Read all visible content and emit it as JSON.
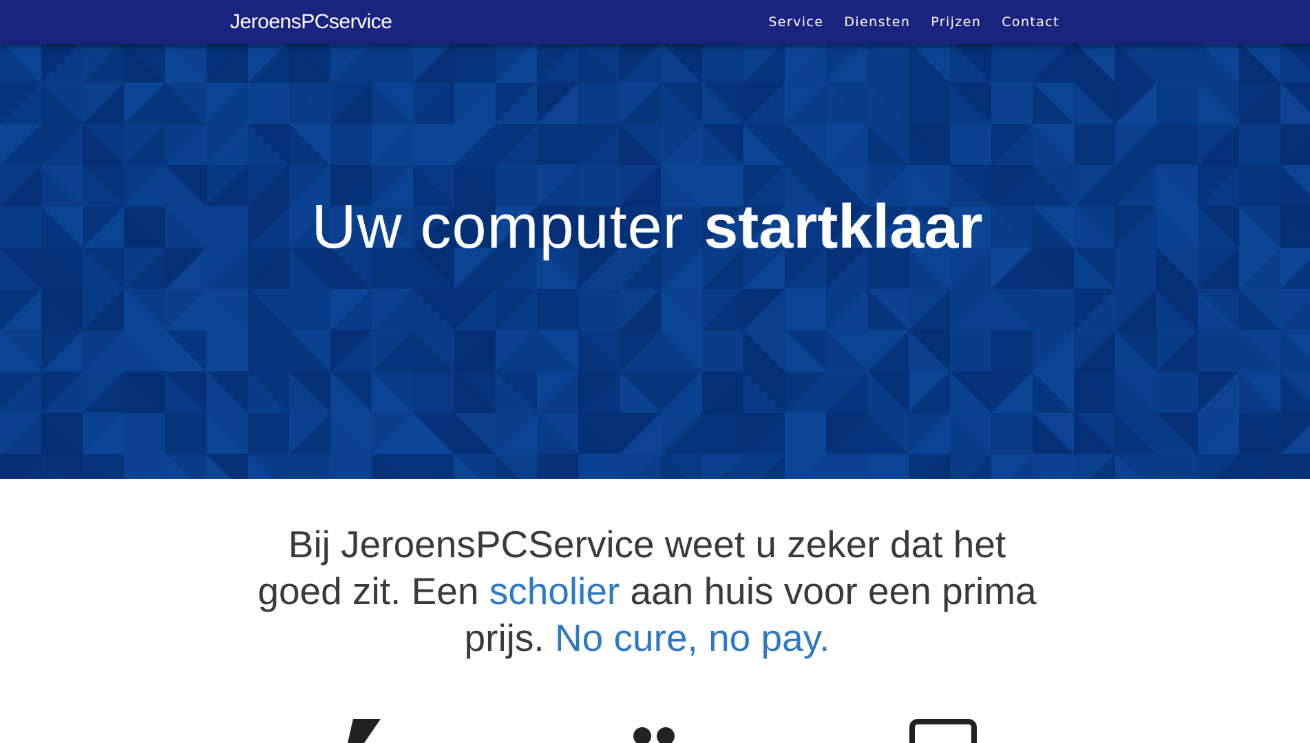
{
  "navbar": {
    "brand": "JeroensPCservice",
    "links": [
      "Service",
      "Diensten",
      "Prijzen",
      "Contact"
    ]
  },
  "hero": {
    "title_light": "Uw computer",
    "title_bold": "startklaar"
  },
  "intro": {
    "part1": "Bij JeroensPCService weet u zeker dat het goed zit. Een",
    "highlight1": "scholier",
    "part2": "aan huis voor een prima prijs.",
    "highlight2": "No cure, no pay."
  },
  "features": {
    "icons": [
      "bolt-icon",
      "users-icon",
      "laptop-icon"
    ]
  },
  "colors": {
    "navbar": "#1a237e",
    "hero": "#073b83",
    "accent": "#2f78c4",
    "text": "#3a3a3a"
  }
}
